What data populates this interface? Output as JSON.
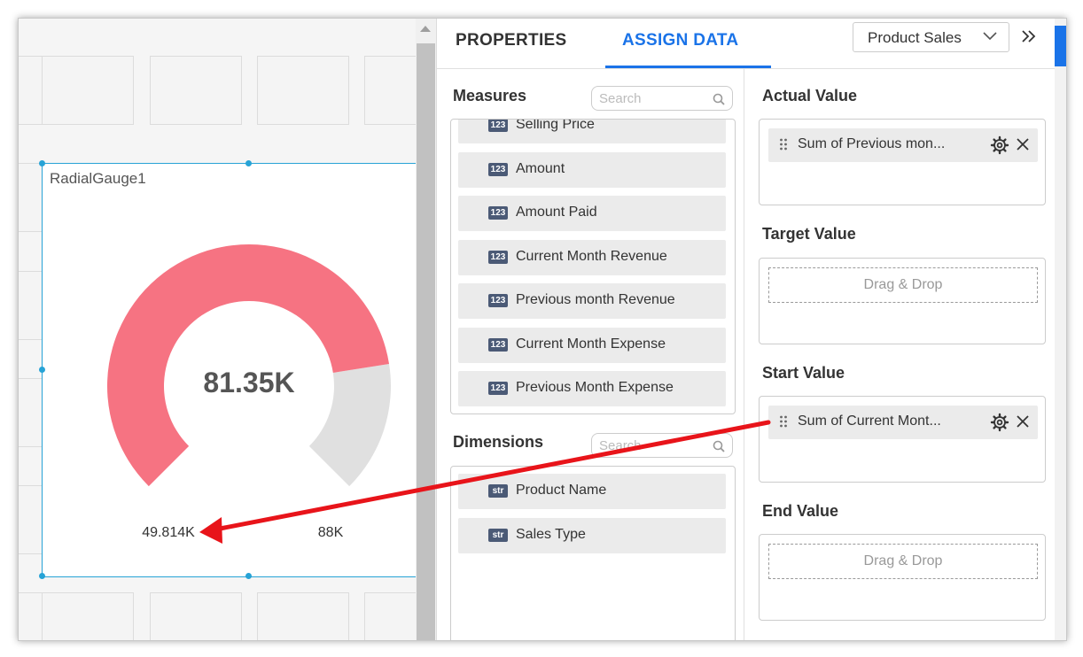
{
  "widget": {
    "title": "RadialGauge1",
    "center_value": "81.35K",
    "min_label": "49.814K",
    "max_label": "88K",
    "value_fraction": 0.8,
    "colors": {
      "fill": "#f67382",
      "track": "#e0e0e0"
    }
  },
  "tabs": {
    "properties": "PROPERTIES",
    "assign_data": "ASSIGN DATA"
  },
  "datasource": {
    "selected": "Product Sales"
  },
  "measures": {
    "title": "Measures",
    "search_placeholder": "Search",
    "items": [
      {
        "type": "123",
        "label": "Selling Price"
      },
      {
        "type": "123",
        "label": "Amount"
      },
      {
        "type": "123",
        "label": "Amount Paid"
      },
      {
        "type": "123",
        "label": "Current Month Revenue"
      },
      {
        "type": "123",
        "label": "Previous month Revenue"
      },
      {
        "type": "123",
        "label": "Current Month Expense"
      },
      {
        "type": "123",
        "label": "Previous Month Expense"
      }
    ]
  },
  "dimensions": {
    "title": "Dimensions",
    "search_placeholder": "Search",
    "items": [
      {
        "type": "str",
        "label": "Product Name"
      },
      {
        "type": "str",
        "label": "Sales Type"
      }
    ]
  },
  "zones": {
    "actual": {
      "title": "Actual Value",
      "chip": "Sum of Previous mon..."
    },
    "target": {
      "title": "Target Value",
      "placeholder": "Drag & Drop"
    },
    "start": {
      "title": "Start Value",
      "chip": "Sum of Current Mont..."
    },
    "end": {
      "title": "End Value",
      "placeholder": "Drag & Drop"
    }
  },
  "icons": {
    "search": "search-icon",
    "chevron": "chevron-down-icon",
    "collapse": "double-chevron-right-icon",
    "grip": "drag-handle-icon",
    "gear": "gear-icon",
    "close": "close-icon"
  },
  "annotation_color": "#e8141a"
}
